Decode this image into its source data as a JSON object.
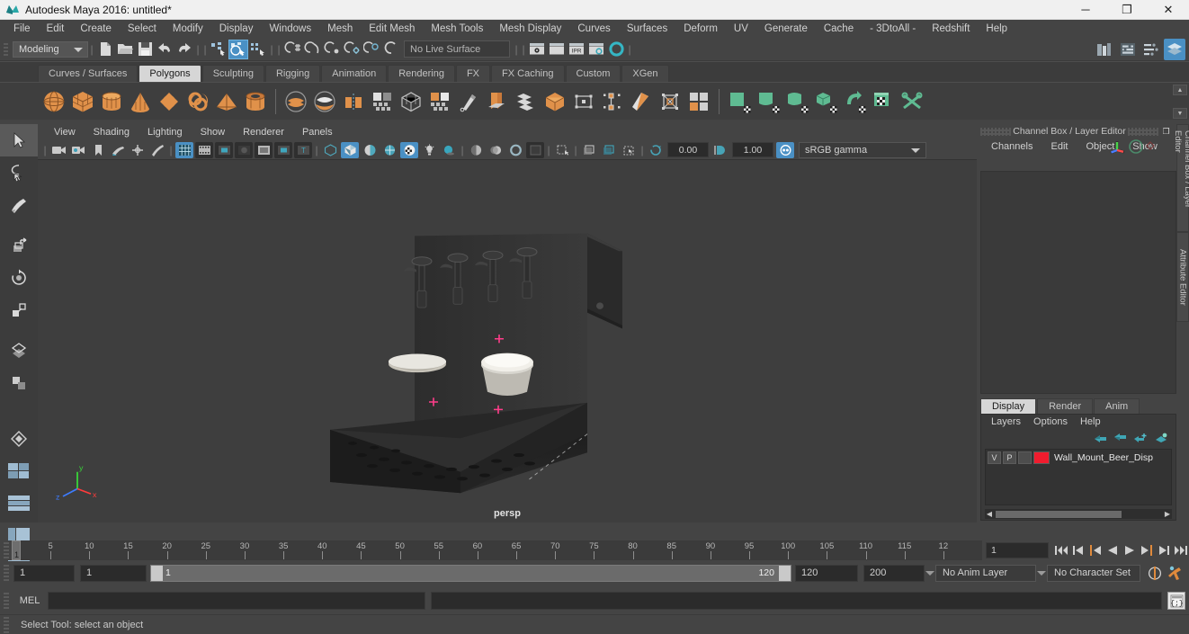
{
  "window": {
    "title": "Autodesk Maya 2016: untitled*",
    "minimize_label": "─",
    "maximize_label": "❐",
    "close_label": "✕"
  },
  "menubar": {
    "items": [
      {
        "label": "File"
      },
      {
        "label": "Edit"
      },
      {
        "label": "Create"
      },
      {
        "label": "Select"
      },
      {
        "label": "Modify"
      },
      {
        "label": "Display"
      },
      {
        "label": "Windows"
      },
      {
        "label": "Mesh"
      },
      {
        "label": "Edit Mesh"
      },
      {
        "label": "Mesh Tools"
      },
      {
        "label": "Mesh Display"
      },
      {
        "label": "Curves"
      },
      {
        "label": "Surfaces"
      },
      {
        "label": "Deform"
      },
      {
        "label": "UV"
      },
      {
        "label": "Generate"
      },
      {
        "label": "Cache"
      },
      {
        "label": "- 3DtoAll -"
      },
      {
        "label": "Redshift"
      },
      {
        "label": "Help"
      }
    ]
  },
  "statusline": {
    "menuset": "Modeling",
    "live_surface": "No Live Surface",
    "icons": [
      "new-scene-icon",
      "open-scene-icon",
      "save-scene-icon",
      "undo-icon",
      "redo-icon",
      "select-by-hierarchy-icon",
      "select-by-object-icon",
      "select-by-component-icon",
      "snap-to-grid-icon",
      "snap-to-curve-icon",
      "snap-to-point-icon",
      "snap-to-projected-center-icon",
      "snap-to-view-plane-icon",
      "make-live-icon",
      "render-current-frame-icon",
      "ipr-render-icon",
      "render-settings-icon",
      "hypershade-icon"
    ],
    "right_icons": [
      "show-hide-modeling-toolkit-icon",
      "attribute-editor-icon",
      "tool-settings-icon",
      "channel-box-icon"
    ]
  },
  "shelf": {
    "tabs": [
      {
        "label": "Curves / Surfaces",
        "active": false
      },
      {
        "label": "Polygons",
        "active": true
      },
      {
        "label": "Sculpting",
        "active": false
      },
      {
        "label": "Rigging",
        "active": false
      },
      {
        "label": "Animation",
        "active": false
      },
      {
        "label": "Rendering",
        "active": false
      },
      {
        "label": "FX",
        "active": false
      },
      {
        "label": "FX Caching",
        "active": false
      },
      {
        "label": "Custom",
        "active": false
      },
      {
        "label": "XGen",
        "active": false
      }
    ],
    "items": [
      "poly-sphere-icon",
      "poly-cube-icon",
      "poly-cylinder-icon",
      "poly-cone-icon",
      "poly-torus-icon",
      "poly-plane-icon",
      "poly-pyramid-icon",
      "poly-pipe-icon",
      "booleans-union-icon",
      "booleans-difference-icon",
      "combine-icon",
      "mirror-geometry-icon",
      "smooth-icon",
      "extrude-icon",
      "multi-cut-icon",
      "bevel-icon",
      "add-divisions-icon",
      "sculpt-geometry-icon",
      "target-weld-icon",
      "bridge-icon",
      "wedge-icon",
      "poly-quad-draw-icon",
      "uv-editor-icon",
      "planar-mapping-icon",
      "cylindrical-mapping-icon",
      "spherical-mapping-icon",
      "automatic-mapping-icon",
      "uv-unfold-icon",
      "uv-layout-icon",
      "uv-cut-sew-icon"
    ],
    "scroll_up": "▲",
    "scroll_down": "▼"
  },
  "toolbox": {
    "items": [
      {
        "name": "select-tool-icon",
        "selected": true
      },
      {
        "name": "lasso-select-tool-icon",
        "selected": false
      },
      {
        "name": "paint-select-tool-icon",
        "selected": false
      },
      {
        "name": "move-tool-icon",
        "selected": false
      },
      {
        "name": "rotate-tool-icon",
        "selected": false
      },
      {
        "name": "scale-tool-icon",
        "selected": false
      },
      {
        "name": "universal-manipulator-icon",
        "selected": false
      },
      {
        "name": "soft-modification-tool-icon",
        "selected": false
      },
      {
        "name": "show-manipulator-tool-icon",
        "selected": false
      },
      {
        "name": "last-tool-used-icon",
        "selected": false
      },
      {
        "name": "single-perspective-view-icon",
        "selected": false
      }
    ]
  },
  "viewport": {
    "menus": [
      {
        "label": "View"
      },
      {
        "label": "Shading"
      },
      {
        "label": "Lighting"
      },
      {
        "label": "Show"
      },
      {
        "label": "Renderer"
      },
      {
        "label": "Panels"
      }
    ],
    "exposure_value": "0.00",
    "gamma_value": "1.00",
    "color_space": "sRGB gamma",
    "camera_label": "persp",
    "toolbar_icons": [
      "select-camera-icon",
      "camera-attributes-icon",
      "bookmark-icon",
      "image-plane-icon",
      "two-d-pan-zoom-icon",
      "grease-pencil-icon",
      "grid-toggle-icon",
      "film-gate-icon",
      "resolution-gate-icon",
      "gate-mask-icon",
      "film-origin-icon",
      "safe-action-icon",
      "title-safe-icon",
      "wireframe-icon",
      "smooth-shade-all-icon",
      "shade-flat-icon",
      "wireframe-on-shaded-icon",
      "textured-icon",
      "use-all-lights-icon",
      "shadows-icon",
      "screen-space-ao-icon",
      "motion-blur-icon",
      "multisample-icon",
      "isolate-select-icon",
      "xray-icon",
      "xray-joints-icon",
      "xray-active-components-icon",
      "exposure-icon",
      "gamma-icon",
      "color-management-icon"
    ]
  },
  "channel_box": {
    "panel_title": "Channel Box / Layer Editor",
    "restore_icon": "❐",
    "close_icon": "✕",
    "tabs": [
      {
        "label": "Channels"
      },
      {
        "label": "Edit"
      },
      {
        "label": "Object"
      },
      {
        "label": "Show"
      }
    ],
    "side_tabs": [
      {
        "label": "Channel Box / Layer Editor"
      },
      {
        "label": "Attribute Editor"
      }
    ]
  },
  "layer_editor": {
    "tabs": [
      {
        "label": "Display",
        "active": true
      },
      {
        "label": "Render",
        "active": false
      },
      {
        "label": "Anim",
        "active": false
      }
    ],
    "menus": [
      {
        "label": "Layers"
      },
      {
        "label": "Options"
      },
      {
        "label": "Help"
      }
    ],
    "toolbar_icons": [
      "move-layer-up-icon",
      "move-layer-down-icon",
      "new-layer-icon",
      "new-layer-from-selected-icon"
    ],
    "layers": [
      {
        "visibility": "V",
        "playback": "P",
        "shading": "",
        "color": "#f01c2e",
        "name": "Wall_Mount_Beer_Disp"
      }
    ],
    "scroll_left_icon": "◀",
    "scroll_right_icon": "▶"
  },
  "timeslider": {
    "start_frame": "1",
    "current_frame": "1",
    "ticks": [
      "5",
      "10",
      "15",
      "20",
      "25",
      "30",
      "35",
      "40",
      "45",
      "50",
      "55",
      "60",
      "65",
      "70",
      "75",
      "80",
      "85",
      "90",
      "95",
      "100",
      "105",
      "110",
      "115",
      "12"
    ],
    "current_frame_field": "1",
    "playback_buttons": [
      "go-to-start-icon",
      "step-back-frame-icon",
      "step-back-key-icon",
      "play-backwards-icon",
      "play-forwards-icon",
      "step-forward-key-icon",
      "step-forward-frame-icon",
      "go-to-end-icon"
    ]
  },
  "range": {
    "anim_start": "1",
    "range_start": "1",
    "bar_start": "1",
    "bar_end": "120",
    "range_end": "120",
    "anim_end": "200",
    "anim_layer": "No Anim Layer",
    "character_set": "No Character Set",
    "auto_key_icon": "auto-keyframe-icon",
    "anim_prefs_icon": "animation-preferences-icon"
  },
  "command_line": {
    "language_label": "MEL",
    "input_value": "",
    "output_value": "",
    "script_editor_icon": "script-editor-icon"
  },
  "helpline": {
    "text": "Select Tool: select an object"
  },
  "colors": {
    "accent_blue": "#4a90c4",
    "shelf_orange": "#e08a3c",
    "shelf_green": "#5fbb92",
    "layer_red": "#f01c2e",
    "panel_bg": "#444444",
    "viewport_bg": "#3e3e3e"
  }
}
